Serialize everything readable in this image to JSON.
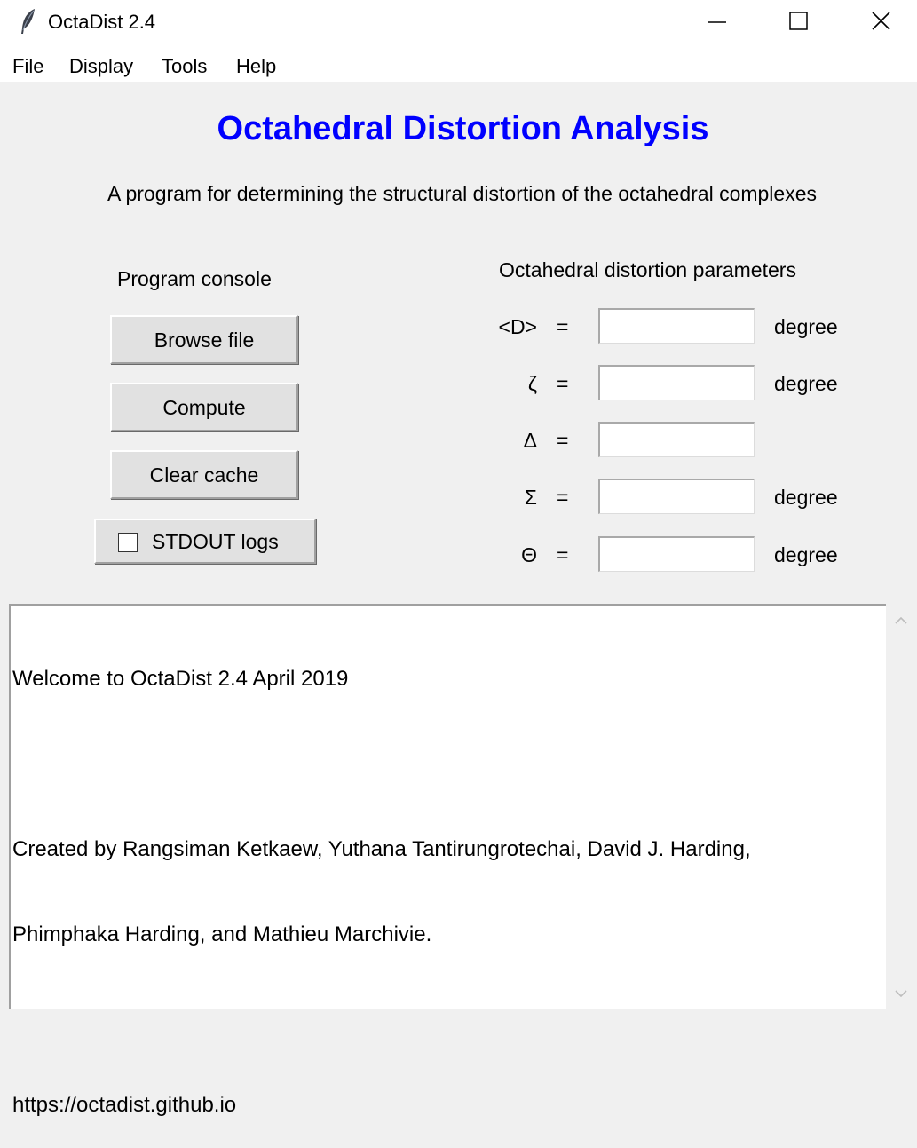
{
  "window": {
    "title": "OctaDist 2.4",
    "icon": "feather-icon"
  },
  "menu": [
    "File",
    "Display",
    "Tools",
    "Help"
  ],
  "header": {
    "title": "Octahedral Distortion Analysis",
    "subtitle": "A program for determining the structural distortion of the octahedral complexes",
    "title_color": "#0000ff"
  },
  "console_panel": {
    "label": "Program console",
    "buttons": [
      "Browse file",
      "Compute",
      "Clear cache"
    ],
    "checkbox_label": "STDOUT logs",
    "checkbox_checked": false
  },
  "parameters": {
    "label": "Octahedral distortion parameters",
    "rows": [
      {
        "symbol": "<D>",
        "equals": "=",
        "value": "",
        "unit": "degree"
      },
      {
        "symbol": "ζ",
        "equals": "=",
        "value": "",
        "unit": "degree"
      },
      {
        "symbol": "Δ",
        "equals": "=",
        "value": "",
        "unit": ""
      },
      {
        "symbol": "Σ",
        "equals": "=",
        "value": "",
        "unit": "degree"
      },
      {
        "symbol": "Θ",
        "equals": "=",
        "value": "",
        "unit": "degree"
      }
    ]
  },
  "console_text": [
    "Welcome to OctaDist 2.4 April 2019",
    "",
    "Created by Rangsiman Ketkaew, Yuthana Tantirungrotechai, David J. Harding,",
    "Phimphaka Harding, and Mathieu Marchivie.",
    "",
    "https://octadist.github.io"
  ]
}
